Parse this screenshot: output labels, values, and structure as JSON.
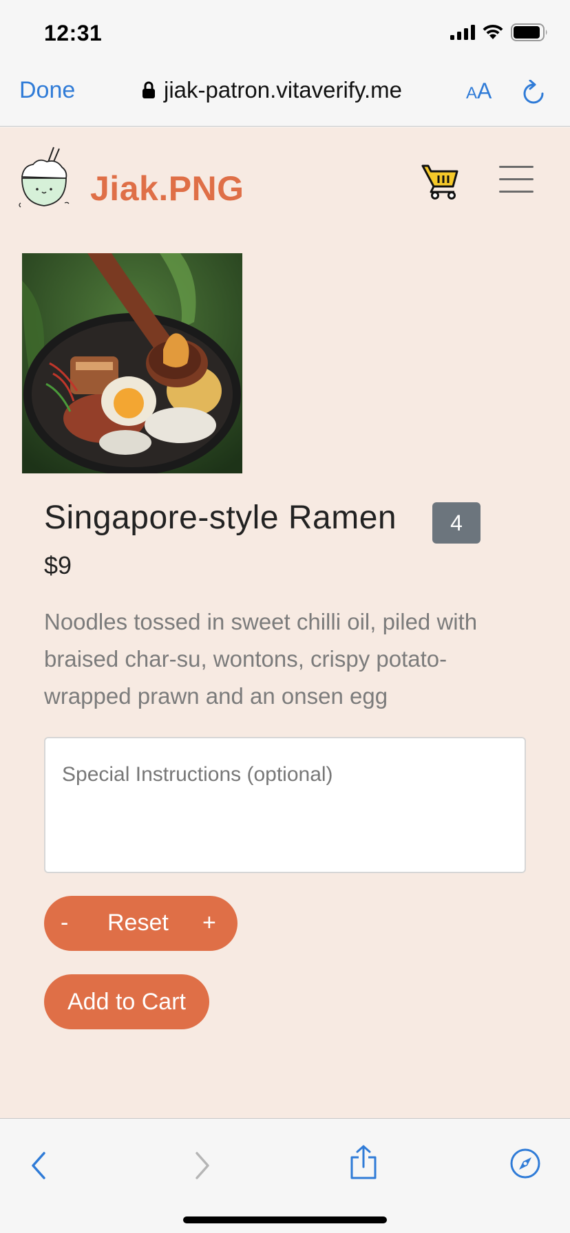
{
  "status_bar": {
    "time": "12:31"
  },
  "browser": {
    "done_label": "Done",
    "url": "jiak-patron.vitaverify.me",
    "text_size_label": "AA"
  },
  "header": {
    "brand": "Jiak.PNG"
  },
  "product": {
    "title": "Singapore-style Ramen",
    "quantity": "4",
    "price": "$9",
    "description": "Noodles tossed in sweet chilli oil, piled with braised char-su, wontons, crispy potato-wrapped prawn and an onsen egg"
  },
  "instructions": {
    "placeholder": "Special Instructions (optional)"
  },
  "stepper": {
    "minus_label": "-",
    "reset_label": "Reset",
    "plus_label": "+"
  },
  "actions": {
    "add_to_cart_label": "Add to Cart"
  },
  "colors": {
    "accent": "#df6f47",
    "page_bg": "#f7eae2",
    "badge": "#6c757d",
    "ios_blue": "#2f7bd7"
  }
}
